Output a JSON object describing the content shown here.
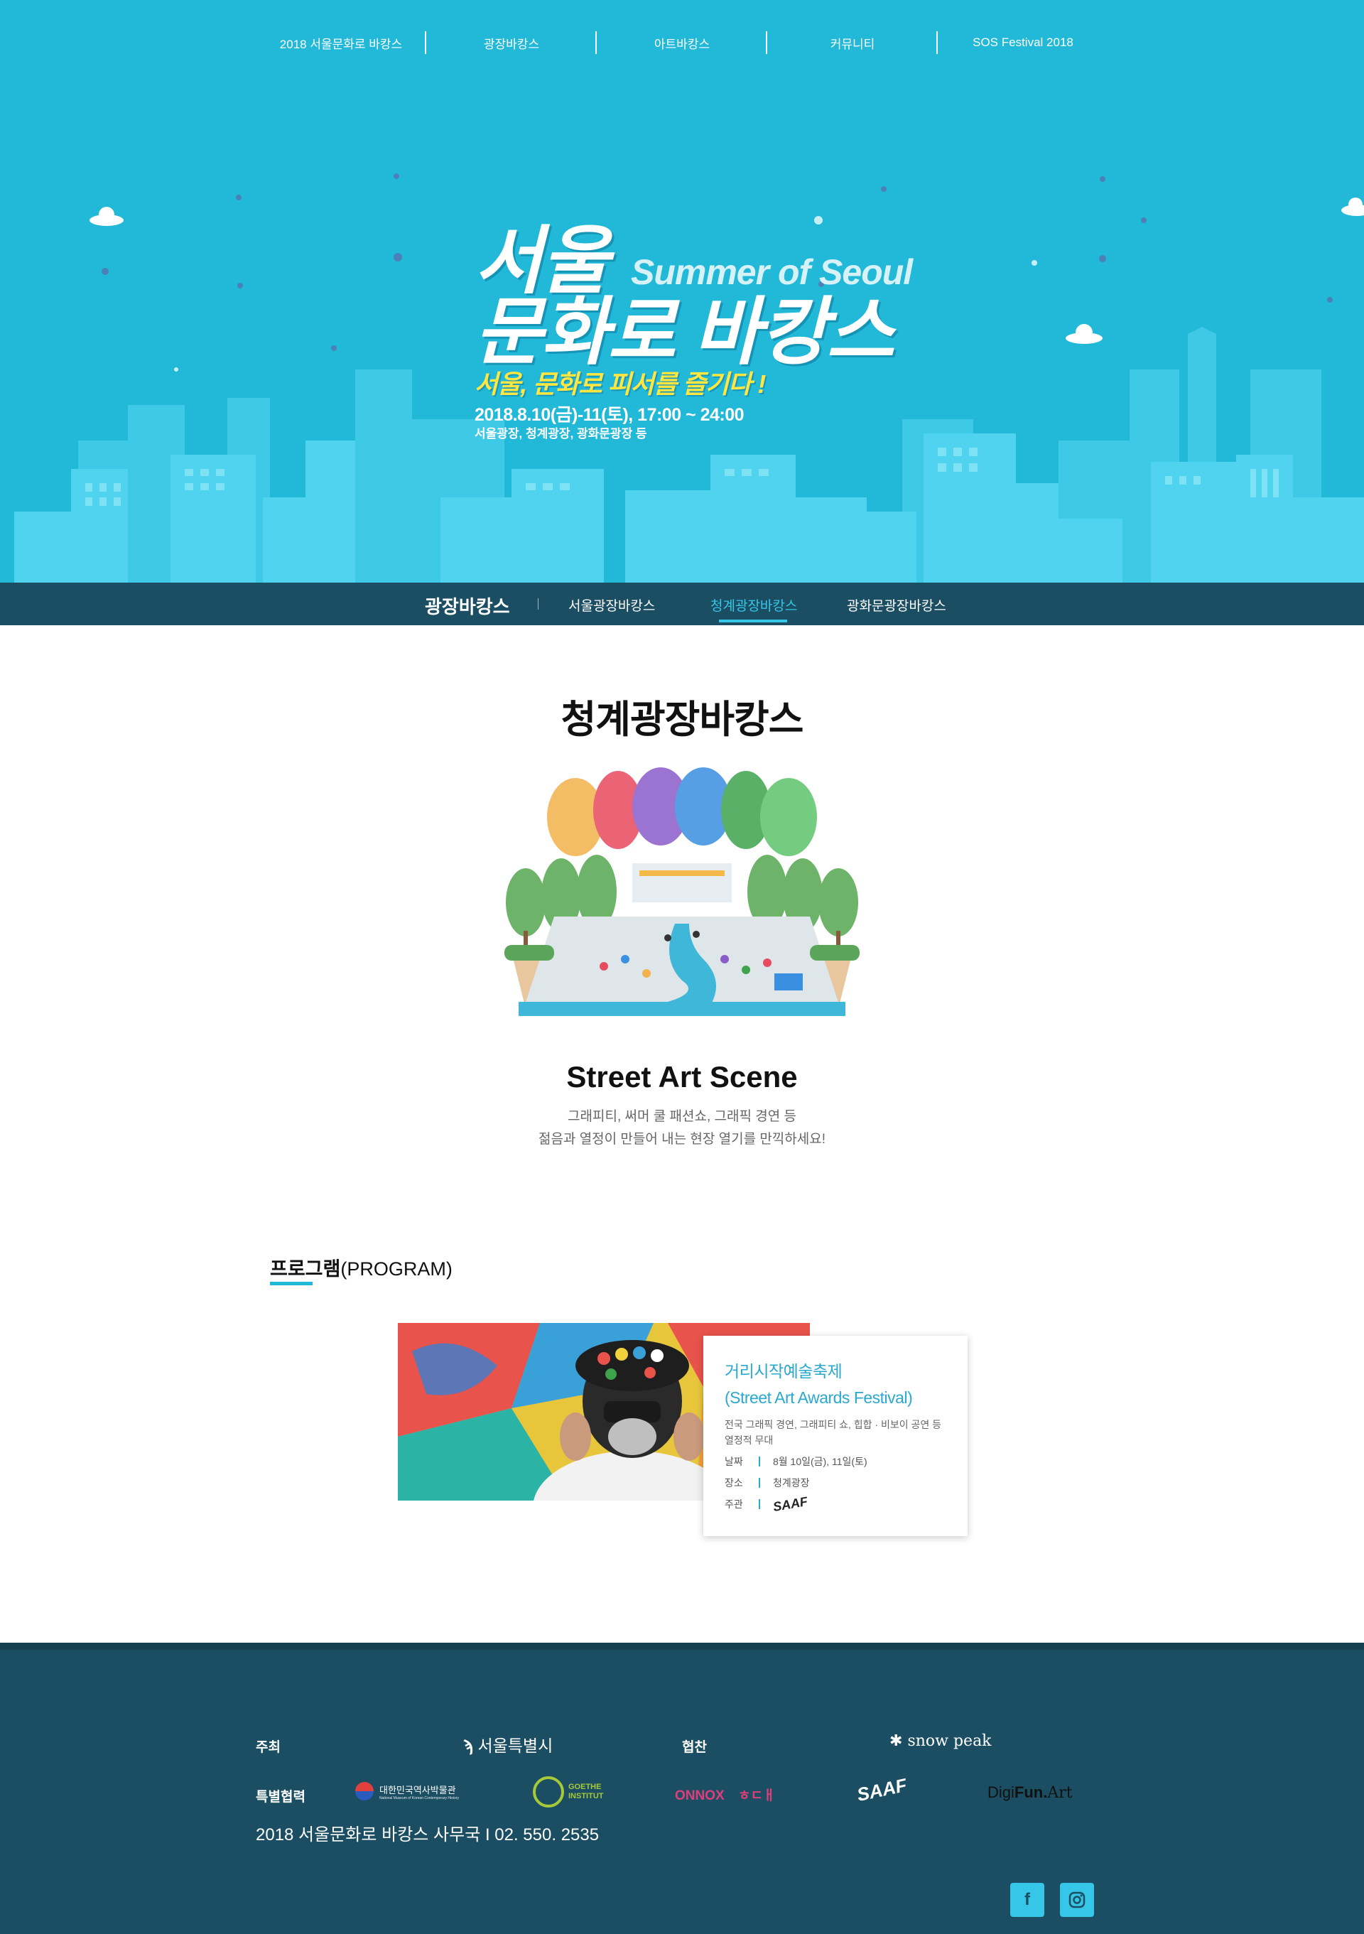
{
  "top_nav": {
    "items": [
      "2018 서울문화로 바캉스",
      "광장바캉스",
      "아트바캉스",
      "커뮤니티",
      "SOS Festival 2018"
    ]
  },
  "hero": {
    "title_line1": "서울",
    "title_line2": "문화로 바캉스",
    "subtitle_en": "Summer of Seoul",
    "tagline": "서울, 문화로 피서를 즐기다 !",
    "date": "2018.8.10(금)-11(토), 17:00 ~ 24:00",
    "venue": "서울광장, 청계광장, 광화문광장 등"
  },
  "sub_nav": {
    "title": "광장바캉스",
    "tabs": [
      "서울광장바캉스",
      "청계광장바캉스",
      "광화문광장바캉스"
    ],
    "active_tab": "청계광장바캉스"
  },
  "main": {
    "page_title": "청계광장바캉스",
    "scene_title": "Street Art Scene",
    "scene_desc_line1": "그래피티, 써머 쿨 패션쇼, 그래픽 경연 등",
    "scene_desc_line2": "젊음과 열정이 만들어 내는 현장 열기를 만끽하세요!"
  },
  "program": {
    "heading_ko": "프로그램",
    "heading_en": "(PROGRAM)",
    "card": {
      "title_ko": "거리시작예술축제",
      "title_en": "(Street Art Awards Festival)",
      "desc": "전국 그래픽 경연, 그래피티 쇼, 힙합 · 비보이 공연 등 열정적 무대",
      "date_label": "날짜",
      "date_value": "8월 10일(금), 11일(토)",
      "place_label": "장소",
      "place_value": "청계광장",
      "host_label": "주관",
      "host_logo": "SAAF"
    }
  },
  "footer": {
    "host_label": "주최",
    "host_logo": "서울특별시",
    "sponsor_label": "협찬",
    "sponsor_logo": "snow peak",
    "special_label": "특별협력",
    "partner_museum": "대한민국역사박물관",
    "partner_museum_en": "National Museum of Korean Contemporary History",
    "partner_goethe_1": "GOETHE",
    "partner_goethe_2": "INSTITUT",
    "partner_red_1": "ONNOX",
    "partner_red_2": "ㅎㄷㅐ",
    "partner_saaf": "SAAF",
    "partner_digi_1": "Digi",
    "partner_digi_2": "Fun.",
    "partner_digi_3": "Art",
    "office": "2018 서울문화로 바캉스 사무국 I 02. 550. 2535",
    "social_icons": [
      "facebook-icon",
      "instagram-icon"
    ]
  },
  "colors": {
    "hero_bg": "#22b8d8",
    "nav_dark": "#1b4e63",
    "accent": "#35c6e8",
    "tagline_yellow": "#ffe640",
    "card_title": "#2aa8d0"
  }
}
